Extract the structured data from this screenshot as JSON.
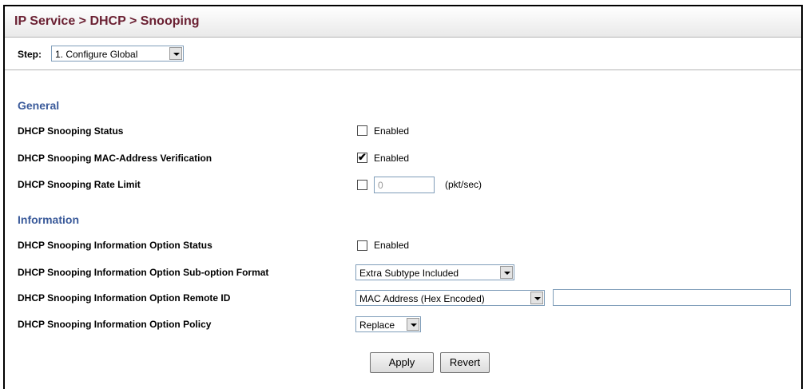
{
  "header": {
    "title": "IP Service > DHCP > Snooping"
  },
  "step": {
    "label": "Step:",
    "selected": "1. Configure Global"
  },
  "general": {
    "heading": "General",
    "status": {
      "label": "DHCP Snooping Status",
      "checked": false,
      "option_label": "Enabled"
    },
    "mac_verification": {
      "label": "DHCP Snooping MAC-Address Verification",
      "checked": true,
      "option_label": "Enabled"
    },
    "rate_limit": {
      "label": "DHCP Snooping Rate Limit",
      "checked": false,
      "value": "0",
      "unit": "(pkt/sec)"
    }
  },
  "information": {
    "heading": "Information",
    "option_status": {
      "label": "DHCP Snooping Information Option Status",
      "checked": false,
      "option_label": "Enabled"
    },
    "suboption_format": {
      "label": "DHCP Snooping Information Option Sub-option Format",
      "selected": "Extra Subtype Included"
    },
    "remote_id": {
      "label": "DHCP Snooping Information Option Remote ID",
      "selected": "MAC Address (Hex Encoded)",
      "text_value": ""
    },
    "policy": {
      "label": "DHCP Snooping Information Option Policy",
      "selected": "Replace"
    }
  },
  "actions": {
    "apply_label": "Apply",
    "revert_label": "Revert"
  },
  "colors": {
    "title": "#6b2133",
    "section_heading": "#3a5a9a"
  }
}
